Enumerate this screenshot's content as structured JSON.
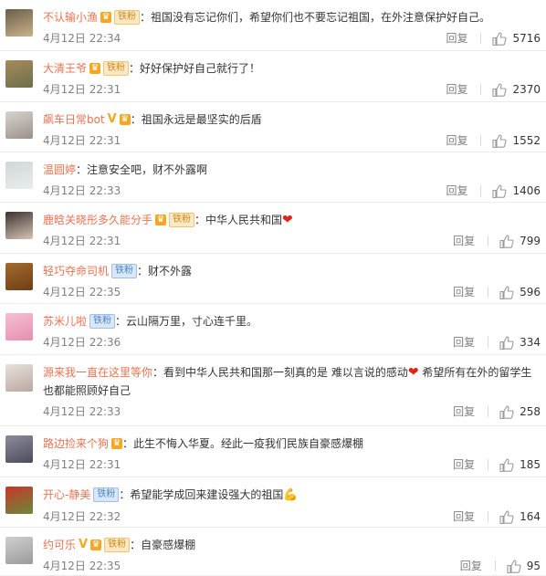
{
  "comments": [
    {
      "user": "不认输小渔",
      "badges": [
        "vip",
        "fan"
      ],
      "text": "祖国没有忘记你们，希望你们也不要忘记祖国，在外注意保护好自己。",
      "time": "4月12日 22:34",
      "reply": "回复",
      "likes": "5716",
      "avatar": {
        "top": "#6b5e4a",
        "bottom": "#c9b28a"
      }
    },
    {
      "user": "大清王爷",
      "badges": [
        "vip",
        "fan"
      ],
      "text": "好好保护好自己就行了！",
      "time": "4月12日 22:31",
      "reply": "回复",
      "likes": "2370",
      "avatar": {
        "top": "#a88b5c",
        "bottom": "#6a6f4a"
      }
    },
    {
      "user": "飙车日常bot",
      "badges": [
        "v",
        "vip"
      ],
      "text": "祖国永远是最坚实的后盾",
      "time": "4月12日 22:31",
      "reply": "回复",
      "likes": "1552",
      "avatar": {
        "top": "#d8d4d0",
        "bottom": "#9a9188"
      }
    },
    {
      "user": "温圆婷",
      "badges": [],
      "text": "注意安全吧，财不外露啊",
      "time": "4月12日 22:33",
      "reply": "回复",
      "likes": "1406",
      "avatar": {
        "top": "#cfd7d9",
        "bottom": "#e9ecec"
      }
    },
    {
      "user": "鹿晗关晓彤多久能分手",
      "badges": [
        "vip",
        "fan"
      ],
      "text": "中华人民共和国",
      "heart": "❤",
      "time": "4月12日 22:31",
      "reply": "回复",
      "likes": "799",
      "avatar": {
        "top": "#3a3330",
        "bottom": "#d7c3b3"
      }
    },
    {
      "user": "轻巧夺命司机",
      "badges": [
        "iron"
      ],
      "text": "财不外露",
      "time": "4月12日 22:35",
      "reply": "回复",
      "likes": "596",
      "avatar": {
        "top": "#a36b2b",
        "bottom": "#6e3e18"
      }
    },
    {
      "user": "苏米儿啦",
      "badges": [
        "iron"
      ],
      "text": "云山隔万里，寸心连千里。",
      "time": "4月12日 22:36",
      "reply": "回复",
      "likes": "334",
      "avatar": {
        "top": "#f5bfd3",
        "bottom": "#e58fb1"
      }
    },
    {
      "user": "源来我一直在这里等你",
      "badges": [],
      "text": "看到中华人民共和国那一刻真的是 难以言说的感动",
      "heart": "❤",
      "text2": " 希望所有在外的留学生也都能照顾好自己",
      "time": "4月12日 22:33",
      "reply": "回复",
      "likes": "258",
      "avatar": {
        "top": "#e9e1dc",
        "bottom": "#b8a8a0"
      }
    },
    {
      "user": "路边捡来个狗",
      "badges": [
        "vip"
      ],
      "text": "此生不悔入华夏。经此一疫我们民族自豪感爆棚",
      "time": "4月12日 22:31",
      "reply": "回复",
      "likes": "185",
      "avatar": {
        "top": "#8c8c9c",
        "bottom": "#4c4c5c"
      }
    },
    {
      "user": "开心-静美",
      "badges": [
        "iron"
      ],
      "text": "希望能学成回来建设强大的祖国",
      "muscle": "💪",
      "time": "4月12日 22:32",
      "reply": "回复",
      "likes": "164",
      "avatar": {
        "top": "#c9372a",
        "bottom": "#6a8a3a"
      }
    },
    {
      "user": "约可乐",
      "badges": [
        "v",
        "vip",
        "fan"
      ],
      "text": "自豪感爆棚",
      "time": "4月12日 22:35",
      "reply": "回复",
      "likes": "95",
      "avatar": {
        "top": "#cfcfcf",
        "bottom": "#9a9a9a"
      }
    }
  ],
  "labels": {
    "vip": "♛",
    "fan": "铁粉",
    "iron": "铁粉",
    "v": "V",
    "colon": "："
  },
  "colors": {
    "username": "#eb7350",
    "meta": "#808080",
    "heart": "#e0241b"
  }
}
